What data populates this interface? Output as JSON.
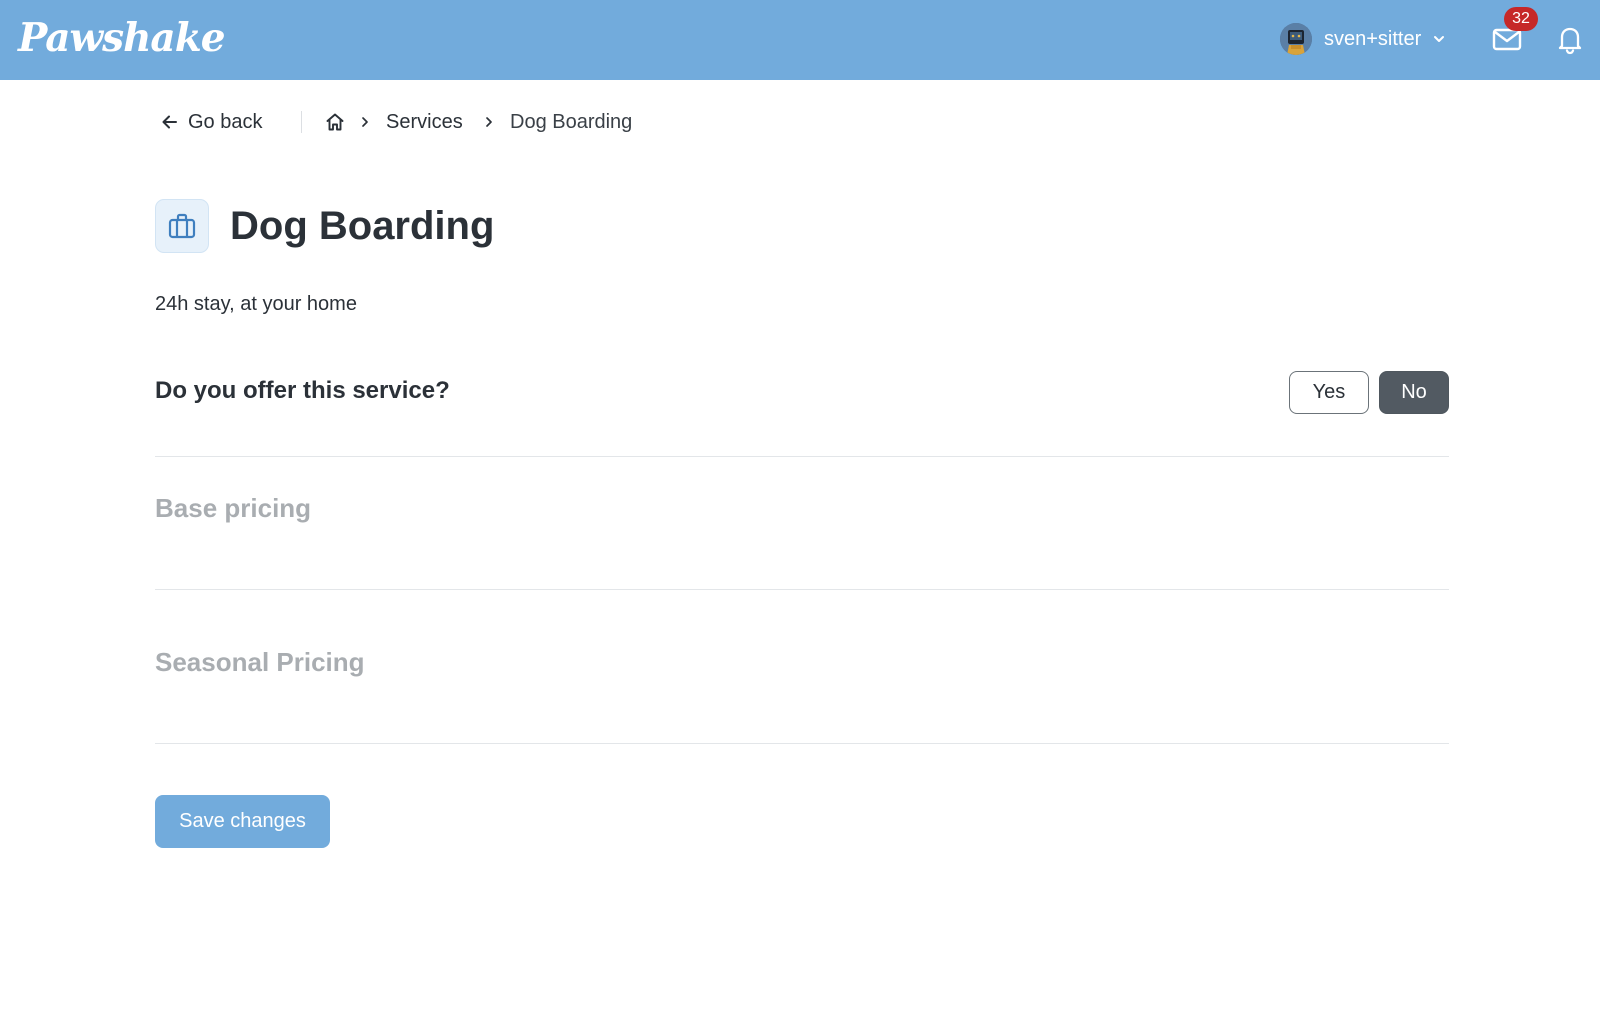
{
  "header": {
    "logo_text": "Pawshake",
    "username": "sven+sitter",
    "inbox_count": "32",
    "brand_color": "#72abdc",
    "badge_color": "#c62828",
    "icons": [
      "avatar",
      "chevron-down-icon",
      "mail-icon",
      "bell-icon"
    ]
  },
  "breadcrumb": {
    "back_label": "Go back",
    "items": [
      "Services",
      "Dog Boarding"
    ],
    "icons": [
      "arrow-left-icon",
      "home-icon",
      "chevron-right-icon"
    ]
  },
  "page": {
    "title": "Dog Boarding",
    "title_icon": "briefcase-icon",
    "subtitle": "24h stay, at your home"
  },
  "offer": {
    "question": "Do you offer this service?",
    "yes_label": "Yes",
    "no_label": "No",
    "selected": "No"
  },
  "sections": {
    "base_pricing": "Base pricing",
    "seasonal_pricing": "Seasonal Pricing"
  },
  "actions": {
    "save_label": "Save changes"
  }
}
